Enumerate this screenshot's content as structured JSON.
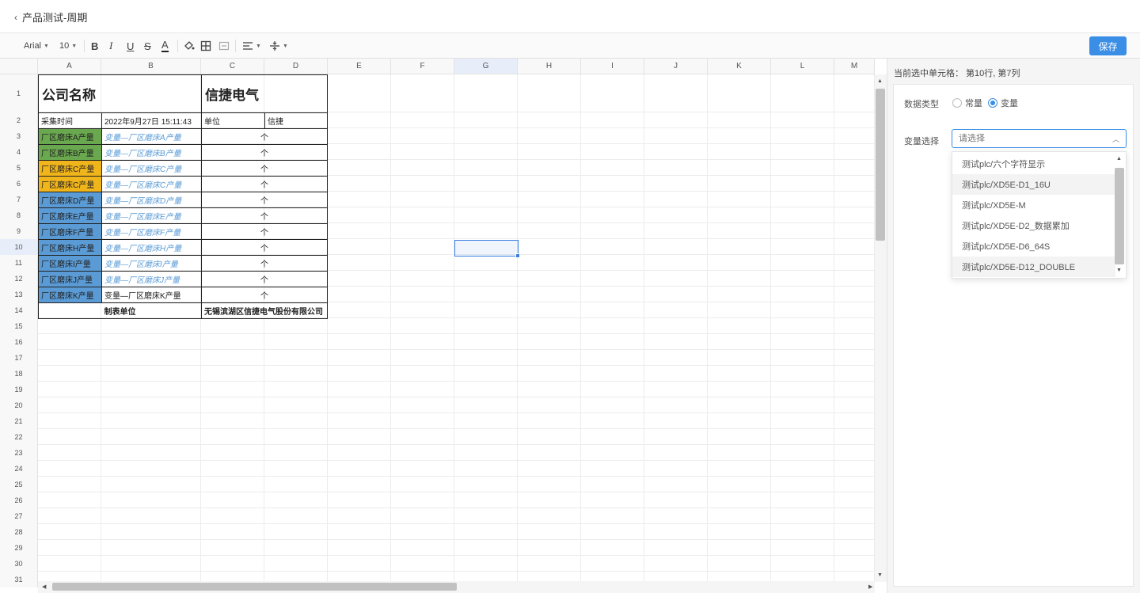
{
  "header": {
    "back_label": "产品测试-周期"
  },
  "toolbar": {
    "font_family": "Arial",
    "font_size": "10",
    "bold": "B",
    "italic": "I",
    "underline": "U",
    "strike": "S",
    "font_color": "A",
    "save_label": "保存"
  },
  "sheet": {
    "columns": [
      "A",
      "B",
      "C",
      "D",
      "E",
      "F",
      "G",
      "H",
      "I",
      "J",
      "K",
      "L",
      "M"
    ],
    "rows": [
      "1",
      "2",
      "3",
      "4",
      "5",
      "6",
      "7",
      "8",
      "9",
      "10",
      "11",
      "12",
      "13",
      "14",
      "15",
      "16",
      "17",
      "18",
      "19",
      "20",
      "21",
      "22",
      "23",
      "24",
      "25",
      "26",
      "27",
      "28",
      "29",
      "30",
      "31"
    ],
    "company_label": "公司名称",
    "company_value": "信捷电气",
    "collect_time_label": "采集时间",
    "collect_time_value": "2022年9月27日 15:11:43",
    "unit_label": "单位",
    "unit_value": "信捷",
    "data_rows": [
      {
        "name": "厂区磨床A产量",
        "var": "变量—厂区磨床A产量",
        "unit": "个",
        "color": "green"
      },
      {
        "name": "厂区磨床B产量",
        "var": "变量—厂区磨床B产量",
        "unit": "个",
        "color": "green"
      },
      {
        "name": "厂区磨床C产量",
        "var": "变量—厂区磨床C产量",
        "unit": "个",
        "color": "orange"
      },
      {
        "name": "厂区磨床C产量",
        "var": "变量—厂区磨床C产量",
        "unit": "个",
        "color": "orange"
      },
      {
        "name": "厂区磨床D产量",
        "var": "变量—厂区磨床D产量",
        "unit": "个",
        "color": "blue"
      },
      {
        "name": "厂区磨床E产量",
        "var": "变量—厂区磨床E产量",
        "unit": "个",
        "color": "blue"
      },
      {
        "name": "厂区磨床F产量",
        "var": "变量—厂区磨床F产量",
        "unit": "个",
        "color": "blue"
      },
      {
        "name": "厂区磨床H产量",
        "var": "变量—厂区磨床H产量",
        "unit": "个",
        "color": "blue"
      },
      {
        "name": "厂区磨床I产量",
        "var": "变量—厂区磨床I产量",
        "unit": "个",
        "color": "blue"
      },
      {
        "name": "厂区磨床J产量",
        "var": "变量—厂区磨床J产量",
        "unit": "个",
        "color": "blue"
      },
      {
        "name": "厂区磨床K产量",
        "var": "变量—厂区磨床K产量",
        "unit": "个",
        "color": "blue"
      }
    ],
    "footer_label": "制表单位",
    "footer_value": "无锡滨湖区信捷电气股份有限公司",
    "selected_col": "G",
    "selected_row": "10"
  },
  "panel": {
    "info": "当前选中单元格：  第10行, 第7列",
    "data_type_label": "数据类型",
    "radio_const": "常量",
    "radio_var": "变量",
    "var_select_label": "变量选择",
    "var_select_placeholder": "请选择",
    "options": [
      "测试plc/六个字符显示",
      "测试plc/XD5E-D1_16U",
      "测试plc/XD5E-M",
      "测试plc/XD5E-D2_数据累加",
      "测试plc/XD5E-D6_64S",
      "测试plc/XD5E-D12_DOUBLE"
    ]
  },
  "colors": {
    "accent": "#3a8ee6",
    "green": "#6aa84f",
    "orange": "#f1b51c",
    "blue": "#5b9bd5"
  }
}
